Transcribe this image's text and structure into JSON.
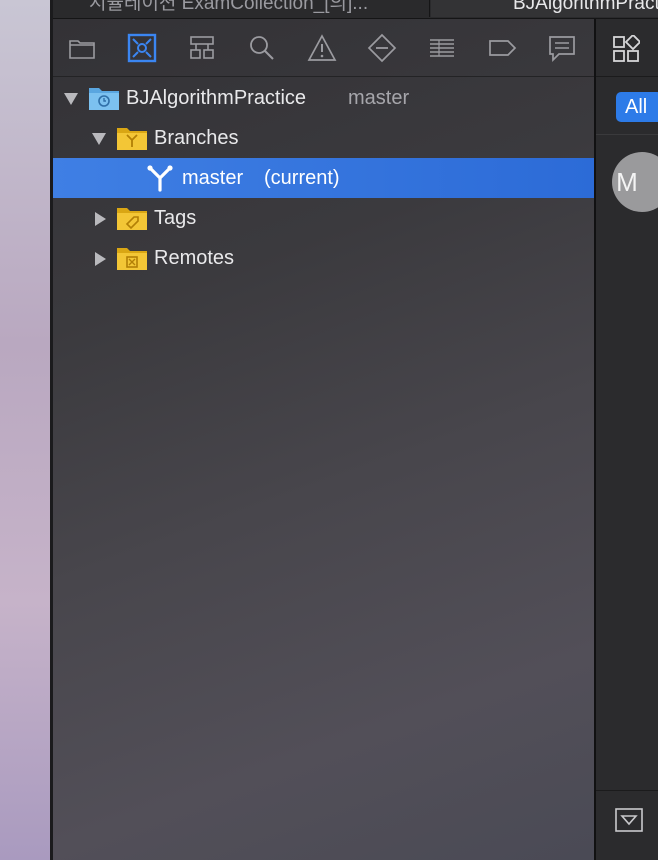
{
  "tabs": [
    {
      "label": "시뮬레이션 ExamCollection_[의]...",
      "active": false
    },
    {
      "label": "BJAlgorithmPractice",
      "active": true
    }
  ],
  "navigator_toolbar": {
    "icons": [
      "folder-icon",
      "source-control-icon",
      "hierarchy-icon",
      "search-icon",
      "warning-icon",
      "test-icon",
      "debug-icon",
      "breakpoint-icon",
      "report-icon"
    ],
    "selected": "source-control-icon"
  },
  "tree": {
    "repository": {
      "name": "BJAlgorithmPractice",
      "branch": "master"
    },
    "branches_label": "Branches",
    "current_branch": {
      "name": "master",
      "suffix": "(current)"
    },
    "tags_label": "Tags",
    "remotes_label": "Remotes"
  },
  "right_pane": {
    "filter_all_label": "All",
    "avatar_initial": "M"
  },
  "colors": {
    "selection": "#2f6ed6",
    "accent": "#2d7be8",
    "folder": "#f0c419",
    "repo_folder": "#6fb8ec"
  }
}
